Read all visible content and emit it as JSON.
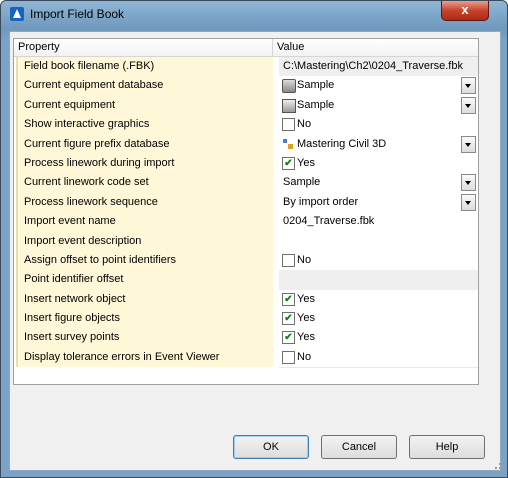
{
  "window": {
    "title": "Import Field Book",
    "close_glyph": "x"
  },
  "grid": {
    "columns": {
      "property": "Property",
      "value": "Value"
    },
    "rows": [
      {
        "label": "Field book filename (.FBK)",
        "value": "C:\\Mastering\\Ch2\\0204_Traverse.fbk",
        "kind": "readonly"
      },
      {
        "label": "Current equipment database",
        "value": "Sample",
        "kind": "dropdown",
        "icon": "database-icon"
      },
      {
        "label": "Current equipment",
        "value": "Sample",
        "kind": "dropdown",
        "icon": "equipment-icon"
      },
      {
        "label": "Show interactive graphics",
        "value": "No",
        "kind": "checkbox",
        "checked": false
      },
      {
        "label": "Current figure prefix database",
        "value": "Mastering Civil 3D",
        "kind": "dropdown",
        "icon": "figure-prefix-icon"
      },
      {
        "label": "Process linework during import",
        "value": "Yes",
        "kind": "checkbox",
        "checked": true
      },
      {
        "label": "Current linework code set",
        "value": "Sample",
        "kind": "dropdown"
      },
      {
        "label": "Process linework sequence",
        "value": "By import order",
        "kind": "dropdown"
      },
      {
        "label": "Import event name",
        "value": "0204_Traverse.fbk",
        "kind": "text"
      },
      {
        "label": "Import event description",
        "value": "",
        "kind": "text"
      },
      {
        "label": "Assign offset to point identifiers",
        "value": "No",
        "kind": "checkbox",
        "checked": false
      },
      {
        "label": "Point identifier offset",
        "value": "",
        "kind": "readonly"
      },
      {
        "label": "Insert network object",
        "value": "Yes",
        "kind": "checkbox",
        "checked": true
      },
      {
        "label": "Insert figure objects",
        "value": "Yes",
        "kind": "checkbox",
        "checked": true
      },
      {
        "label": "Insert survey points",
        "value": "Yes",
        "kind": "checkbox",
        "checked": true
      },
      {
        "label": "Display tolerance errors in Event Viewer",
        "value": "No",
        "kind": "checkbox",
        "checked": false
      }
    ]
  },
  "buttons": {
    "ok": "OK",
    "cancel": "Cancel",
    "help": "Help"
  },
  "colors": {
    "property_bg": "#fff8d8",
    "title_bar": "#7aa3c6",
    "check": "#1a7f1a"
  }
}
